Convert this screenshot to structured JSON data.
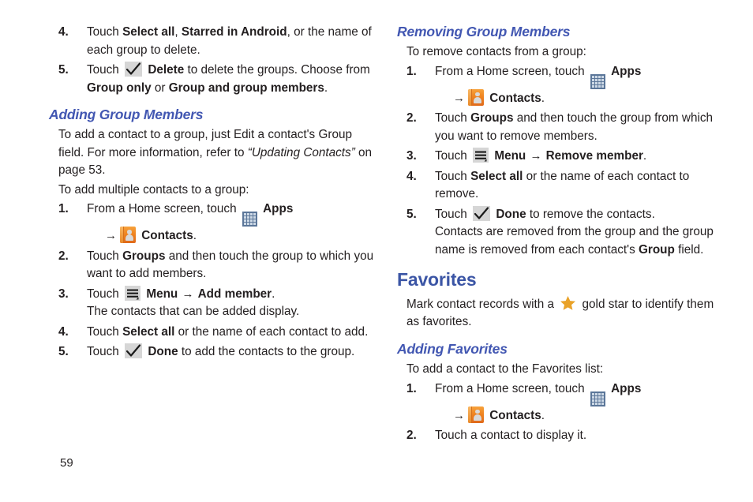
{
  "page": {
    "number": "59"
  },
  "left_column": {
    "steps_top": [
      {
        "num": "4.",
        "parts": [
          {
            "t": "Touch ",
            "s": "n"
          },
          {
            "t": "Select all",
            "s": "b"
          },
          {
            "t": ", ",
            "s": "n"
          },
          {
            "t": "Starred in Android",
            "s": "b"
          },
          {
            "t": ", or the name of each group to delete.",
            "s": "n"
          }
        ]
      },
      {
        "num": "5.",
        "parts": [
          {
            "t": "Touch ",
            "s": "n"
          },
          {
            "t": "check-icon",
            "s": "icon-check"
          },
          {
            "t": "Delete",
            "s": "b"
          },
          {
            "t": " to delete the groups. Choose from ",
            "s": "n"
          },
          {
            "t": "Group only",
            "s": "b"
          },
          {
            "t": " or ",
            "s": "n"
          },
          {
            "t": "Group and group members",
            "s": "b"
          },
          {
            "t": ".",
            "s": "n"
          }
        ]
      }
    ],
    "heading": "Adding Group Members",
    "intro_1_parts": [
      {
        "t": "To add a contact to a group, just Edit a contact's Group field. For more information, refer to ",
        "s": "n"
      },
      {
        "t": "“Updating Contacts”",
        "s": "i"
      },
      {
        "t": " on page 53.",
        "s": "n"
      }
    ],
    "intro_2": "To add multiple contacts to a group:",
    "steps": [
      {
        "num": "1.",
        "parts": [
          {
            "t": "From a Home screen, touch ",
            "s": "n"
          },
          {
            "t": "apps-icon",
            "s": "icon-apps"
          },
          {
            "t": "Apps",
            "s": "b"
          }
        ],
        "cont_arrow": [
          {
            "t": "→",
            "s": "arrow"
          },
          {
            "t": "contacts-icon",
            "s": "icon-contacts"
          },
          {
            "t": "Contacts",
            "s": "b"
          },
          {
            "t": ".",
            "s": "n"
          }
        ]
      },
      {
        "num": "2.",
        "parts": [
          {
            "t": "Touch ",
            "s": "n"
          },
          {
            "t": "Groups",
            "s": "b"
          },
          {
            "t": " and then touch the group to which you want to add members.",
            "s": "n"
          }
        ]
      },
      {
        "num": "3.",
        "parts": [
          {
            "t": "Touch ",
            "s": "n"
          },
          {
            "t": "menu-icon",
            "s": "icon-menu"
          },
          {
            "t": "Menu",
            "s": "b"
          },
          {
            "t": " → ",
            "s": "arrow"
          },
          {
            "t": "Add member",
            "s": "b"
          },
          {
            "t": ".",
            "s": "n"
          }
        ],
        "cont": "The contacts that can be added display."
      },
      {
        "num": "4.",
        "parts": [
          {
            "t": "Touch ",
            "s": "n"
          },
          {
            "t": "Select all",
            "s": "b"
          },
          {
            "t": " or the name of each contact to add.",
            "s": "n"
          }
        ]
      },
      {
        "num": "5.",
        "parts": [
          {
            "t": "Touch ",
            "s": "n"
          },
          {
            "t": "check-icon",
            "s": "icon-check"
          },
          {
            "t": "Done",
            "s": "b"
          },
          {
            "t": " to add the contacts to the group.",
            "s": "n"
          }
        ]
      }
    ]
  },
  "right_column": {
    "heading_removing": "Removing Group Members",
    "intro_removing": "To remove contacts from a group:",
    "steps_removing": [
      {
        "num": "1.",
        "parts": [
          {
            "t": "From a Home screen, touch ",
            "s": "n"
          },
          {
            "t": "apps-icon",
            "s": "icon-apps"
          },
          {
            "t": "Apps",
            "s": "b"
          }
        ],
        "cont_arrow": [
          {
            "t": "→",
            "s": "arrow"
          },
          {
            "t": "contacts-icon",
            "s": "icon-contacts"
          },
          {
            "t": "Contacts",
            "s": "b"
          },
          {
            "t": ".",
            "s": "n"
          }
        ]
      },
      {
        "num": "2.",
        "parts": [
          {
            "t": "Touch ",
            "s": "n"
          },
          {
            "t": "Groups",
            "s": "b"
          },
          {
            "t": " and then touch the group from which you want to remove members.",
            "s": "n"
          }
        ]
      },
      {
        "num": "3.",
        "parts": [
          {
            "t": "Touch ",
            "s": "n"
          },
          {
            "t": "menu-icon",
            "s": "icon-menu"
          },
          {
            "t": "Menu",
            "s": "b"
          },
          {
            "t": " → ",
            "s": "arrow"
          },
          {
            "t": "Remove member",
            "s": "b"
          },
          {
            "t": ".",
            "s": "n"
          }
        ]
      },
      {
        "num": "4.",
        "parts": [
          {
            "t": "Touch ",
            "s": "n"
          },
          {
            "t": "Select all",
            "s": "b"
          },
          {
            "t": " or the name of each contact to remove.",
            "s": "n"
          }
        ]
      },
      {
        "num": "5.",
        "parts": [
          {
            "t": "Touch ",
            "s": "n"
          },
          {
            "t": "check-icon",
            "s": "icon-check"
          },
          {
            "t": "Done",
            "s": "b"
          },
          {
            "t": " to remove the contacts.",
            "s": "n"
          }
        ],
        "cont_parts": [
          {
            "t": "Contacts are removed from the group and the group name is removed from each contact's ",
            "s": "n"
          },
          {
            "t": "Group",
            "s": "b"
          },
          {
            "t": " field.",
            "s": "n"
          }
        ]
      }
    ],
    "heading_favorites": "Favorites",
    "favorites_intro_parts": [
      {
        "t": "Mark contact records with a ",
        "s": "n"
      },
      {
        "t": "star-icon",
        "s": "icon-star"
      },
      {
        "t": "gold star to identify them as favorites.",
        "s": "n"
      }
    ],
    "heading_adding_favorites": "Adding Favorites",
    "intro_adding_favorites": "To add a contact to the Favorites list:",
    "steps_favorites": [
      {
        "num": "1.",
        "parts": [
          {
            "t": "From a Home screen, touch ",
            "s": "n"
          },
          {
            "t": "apps-icon",
            "s": "icon-apps"
          },
          {
            "t": "Apps",
            "s": "b"
          }
        ],
        "cont_arrow": [
          {
            "t": "→",
            "s": "arrow"
          },
          {
            "t": "contacts-icon",
            "s": "icon-contacts"
          },
          {
            "t": "Contacts",
            "s": "b"
          },
          {
            "t": ".",
            "s": "n"
          }
        ]
      },
      {
        "num": "2.",
        "parts": [
          {
            "t": "Touch a contact to display it.",
            "s": "n"
          }
        ]
      }
    ]
  },
  "colors": {
    "heading_h1": "#3b55a5",
    "heading_h2": "#4257b2",
    "body_text": "#231f20",
    "apps_icon": "#5b7699",
    "contacts_icon": "#ef8421",
    "star_icon": "#e9a228"
  }
}
